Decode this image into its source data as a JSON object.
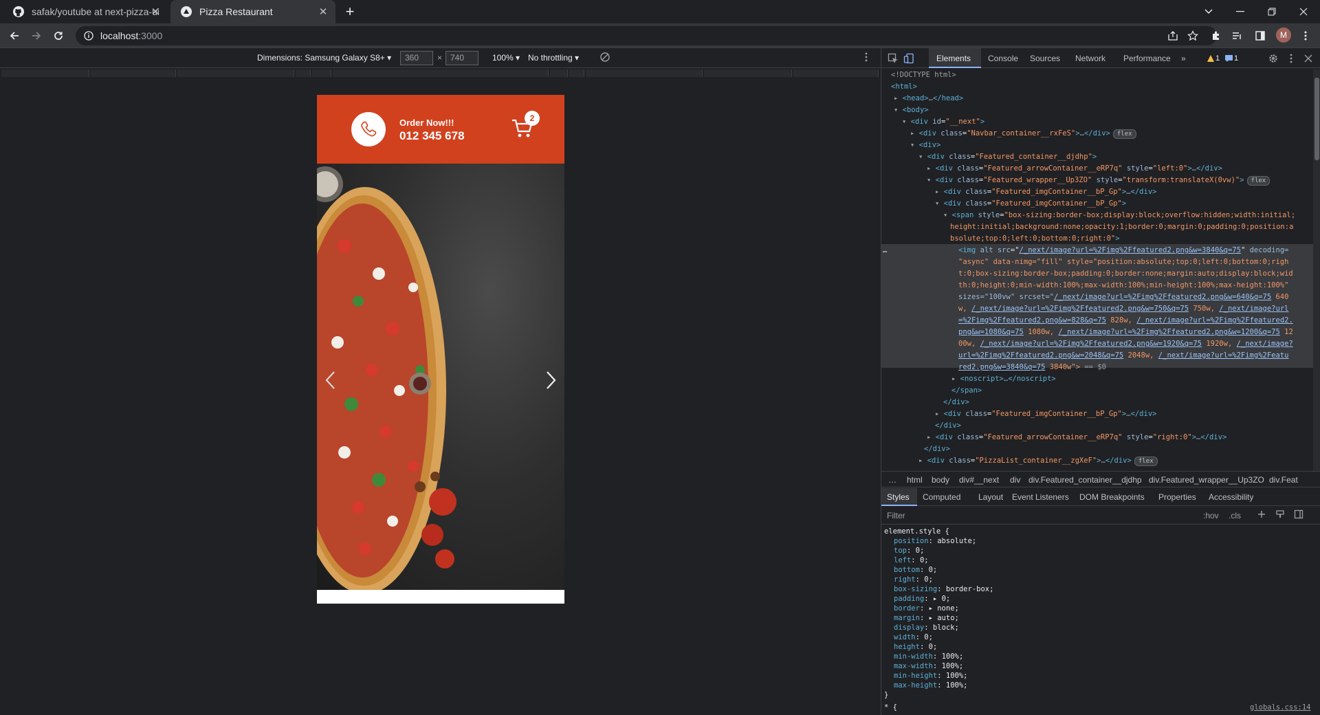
{
  "browser": {
    "tabs": [
      {
        "title": "safak/youtube at next-pizza-ui",
        "icon": "github-icon"
      },
      {
        "title": "Pizza Restaurant",
        "icon": "nextjs-icon"
      }
    ],
    "url_host": "localhost",
    "url_port": ":3000",
    "avatar_letter": "M"
  },
  "device_toolbar": {
    "dimensions_label": "Dimensions: Samsung Galaxy S8+",
    "width": "360",
    "height": "740",
    "times": "×",
    "zoom": "100%",
    "throttling": "No throttling"
  },
  "site": {
    "order_label": "Order Now!!!",
    "phone": "012 345 678",
    "cart_count": "2",
    "brand_color": "#d1411e"
  },
  "devtools": {
    "tabs": [
      "Elements",
      "Console",
      "Sources",
      "Network",
      "Performance"
    ],
    "more": "»",
    "warnings": "1",
    "messages": "1",
    "dom": {
      "doctype": "<!DOCTYPE html>",
      "html": "<html>",
      "head_open": "<head>",
      "head_ellipsis": "…",
      "head_close": "</head>",
      "body": "<body>",
      "div": "<div",
      "close_gt": ">",
      "close_div": "</div>",
      "ellipsis": "…",
      "id_attr": "id",
      "id_val": "\"__next\"",
      "class_attr": "class",
      "style_attr": "style",
      "navbar_class": "\"Navbar_container__rxFeS\"",
      "featured_container": "\"Featured_container__djdhp\"",
      "arrow_container": "\"Featured_arrowContainer__eRP7q\"",
      "left_style": "\"left:0\"",
      "right_style": "\"right:0\"",
      "wrapper_class": "\"Featured_wrapper__Up3ZO\"",
      "wrapper_style": "\"transform:translateX(0vw)\"",
      "img_container": "\"Featured_imgContainer__bP_Gp\"",
      "span_open": "<span",
      "span_style_1": "\"box-sizing:border-box;display:block;overflow:hidden;width:initial;",
      "span_style_2": "height:initial;background:none;opacity:1;border:0;margin:0;padding:0;position:a",
      "span_style_3": "bsolute;top:0;left:0;bottom:0;right:0\"",
      "img_line_1_a": "<img",
      "img_line_1_b": "alt",
      "img_line_1_c": "src",
      "img_line_1_d": "/_next/image?url=%2Fimg%2Ffeatured2.png&w=3840&q=75",
      "img_line_1_e": "decoding=",
      "img_line_2": "\"async\" data-nimg=\"fill\" style=\"position:absolute;top:0;left:0;bottom:0;righ",
      "img_line_3": "t:0;box-sizing:border-box;padding:0;border:none;margin:auto;display:block;wid",
      "img_line_4": "th:0;height:0;min-width:100%;max-width:100%;min-height:100%;max-height:100%\"",
      "img_line_5_a": "sizes=\"100vw\" srcset=\"",
      "img_line_5_b": "/_next/image?url=%2Fimg%2Ffeatured2.png&w=640&q=75",
      "img_line_5_c": " 640",
      "img_line_6_a": "w, ",
      "img_line_6_b": "/_next/image?url=%2Fimg%2Ffeatured2.png&w=750&q=75",
      "img_line_6_c": " 750w, ",
      "img_line_6_d": "/_next/image?url",
      "img_line_7_a": "=%2Fimg%2Ffeatured2.png&w=828&q=75",
      "img_line_7_b": " 828w, ",
      "img_line_7_c": "/_next/image?url=%2Fimg%2Ffeatured2.",
      "img_line_8_a": "png&w=1080&q=75",
      "img_line_8_b": " 1080w, ",
      "img_line_8_c": "/_next/image?url=%2Fimg%2Ffeatured2.png&w=1200&q=75",
      "img_line_8_d": " 12",
      "img_line_9_a": "00w, ",
      "img_line_9_b": "/_next/image?url=%2Fimg%2Ffeatured2.png&w=1920&q=75",
      "img_line_9_c": " 1920w, ",
      "img_line_9_d": "/_next/image?",
      "img_line_10_a": "url=%2Fimg%2Ffeatured2.png&w=2048&q=75",
      "img_line_10_b": " 2048w, ",
      "img_line_10_c": "/_next/image?url=%2Fimg%2Featu",
      "img_line_11_a": "red2.png&w=3840&q=75",
      "img_line_11_b": " 3840w\">",
      "img_line_11_c": " == $0",
      "noscript": "<noscript>…</noscript>",
      "span_close": "</span>",
      "pizzalist_class": "\"PizzaList_container__zgXeF\"",
      "flex_badge": "flex",
      "more_dots": "…"
    },
    "breadcrumbs": [
      "…",
      "html",
      "body",
      "div#__next",
      "div",
      "div.Featured_container__djdhp",
      "div.Featured_wrapper__Up3ZO",
      "div.Feat"
    ],
    "styles_tabs": [
      "Styles",
      "Computed",
      "Layout",
      "Event Listeners",
      "DOM Breakpoints",
      "Properties",
      "Accessibility"
    ],
    "filter_placeholder": "Filter",
    "hov": ":hov",
    "cls": ".cls",
    "element_style_selector": "element.style {",
    "styles": [
      {
        "prop": "position",
        "val": "absolute;"
      },
      {
        "prop": "top",
        "val": "0;"
      },
      {
        "prop": "left",
        "val": "0;"
      },
      {
        "prop": "bottom",
        "val": "0;"
      },
      {
        "prop": "right",
        "val": "0;"
      },
      {
        "prop": "box-sizing",
        "val": "border-box;"
      },
      {
        "prop": "padding",
        "val": "▸ 0;"
      },
      {
        "prop": "border",
        "val": "▸ none;"
      },
      {
        "prop": "margin",
        "val": "▸ auto;"
      },
      {
        "prop": "display",
        "val": "block;"
      },
      {
        "prop": "width",
        "val": "0;"
      },
      {
        "prop": "height",
        "val": "0;"
      },
      {
        "prop": "min-width",
        "val": "100%;"
      },
      {
        "prop": "max-width",
        "val": "100%;"
      },
      {
        "prop": "min-height",
        "val": "100%;"
      },
      {
        "prop": "max-height",
        "val": "100%;"
      }
    ],
    "close_brace": "}",
    "next_rule": "* {",
    "source_link": "globals.css:14"
  }
}
